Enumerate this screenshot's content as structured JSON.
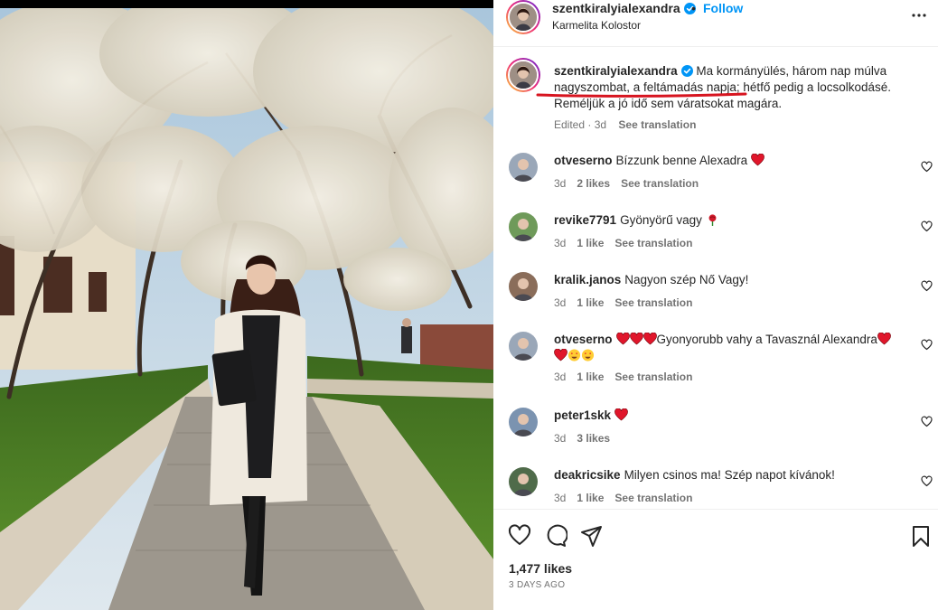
{
  "post": {
    "username": "szentkiralyialexandra",
    "follow_label": "Follow",
    "separator": "•",
    "location": "Karmelita Kolostor",
    "caption_text": "Ma kormányülés, három nap múlva nagyszombat, a feltámadás napja; hétfő pedig a locsolkodásé. Reméljük a jó idő sem váratsokat magára.",
    "caption_edited": "Edited · 3d",
    "see_translation": "See translation",
    "likes": "1,477 likes",
    "timestamp": "3 DAYS AGO"
  },
  "comments": [
    {
      "user": "otveserno",
      "text": "Bízzunk benne Alexadra",
      "emoji": "heart",
      "age": "3d",
      "likes": "2 likes",
      "translate": "See translation",
      "avatar_color": "#9aa7b8"
    },
    {
      "user": "revike7791",
      "text": "Gyönyörű vagy",
      "emoji": "rose",
      "age": "3d",
      "likes": "1 like",
      "translate": "See translation",
      "avatar_color": "#6f9a5a"
    },
    {
      "user": "kralik.janos",
      "text": "Nagyon szép Nő Vagy!",
      "emoji": "",
      "age": "3d",
      "likes": "1 like",
      "translate": "See translation",
      "avatar_color": "#8a6d5a"
    },
    {
      "user": "otveserno",
      "text": "Gyonyorubb vahy a Tavasznál Alexandra",
      "emoji": "hearts",
      "age": "3d",
      "likes": "1 like",
      "translate": "See translation",
      "avatar_color": "#9aa7b8"
    },
    {
      "user": "peter1skk",
      "text": "",
      "emoji": "heart",
      "age": "3d",
      "likes": "3 likes",
      "translate": "",
      "avatar_color": "#7b93b0"
    },
    {
      "user": "deakricsike",
      "text": "Milyen csinos ma! Szép napot kívánok!",
      "emoji": "",
      "age": "3d",
      "likes": "1 like",
      "translate": "See translation",
      "avatar_color": "#4f6b4a"
    }
  ],
  "icons": {
    "more": "more-icon",
    "verified": "verified-badge-icon",
    "like": "heart-outline-icon",
    "comment": "comment-icon",
    "share": "share-icon",
    "save": "bookmark-icon"
  },
  "colors": {
    "accent": "#0095f6",
    "verified": "#0095f6",
    "heart_red": "#e0162b",
    "annotation_red": "#d7141f",
    "muted": "#737373"
  }
}
